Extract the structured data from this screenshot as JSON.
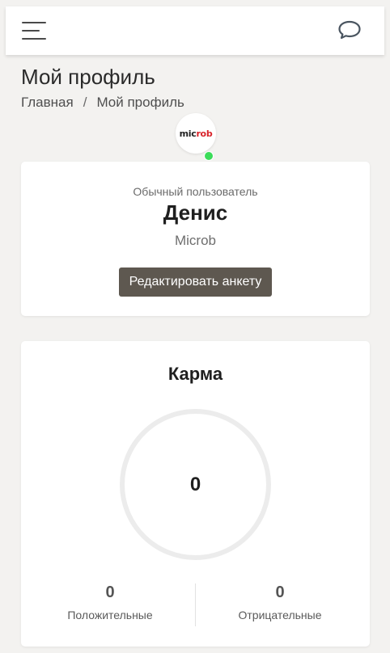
{
  "header": {
    "menu_icon": "hamburger-menu-icon",
    "chat_icon": "chat-bubble-icon"
  },
  "page": {
    "title": "Мой профиль"
  },
  "breadcrumb": {
    "home": "Главная",
    "separator": "/",
    "current": "Мой профиль"
  },
  "profile": {
    "avatar_logo_dark": "mic",
    "avatar_logo_red": "rob",
    "status_color": "#3cdc5a",
    "role": "Обычный пользователь",
    "name": "Денис",
    "company": "Microb",
    "edit_button": "Редактировать анкету"
  },
  "karma": {
    "title": "Карма",
    "total": "0",
    "positive_count": "0",
    "positive_label": "Положительные",
    "negative_count": "0",
    "negative_label": "Отрицательные"
  },
  "colors": {
    "background": "#f3f2f0",
    "button": "#5e5850",
    "online": "#3cdc5a"
  }
}
